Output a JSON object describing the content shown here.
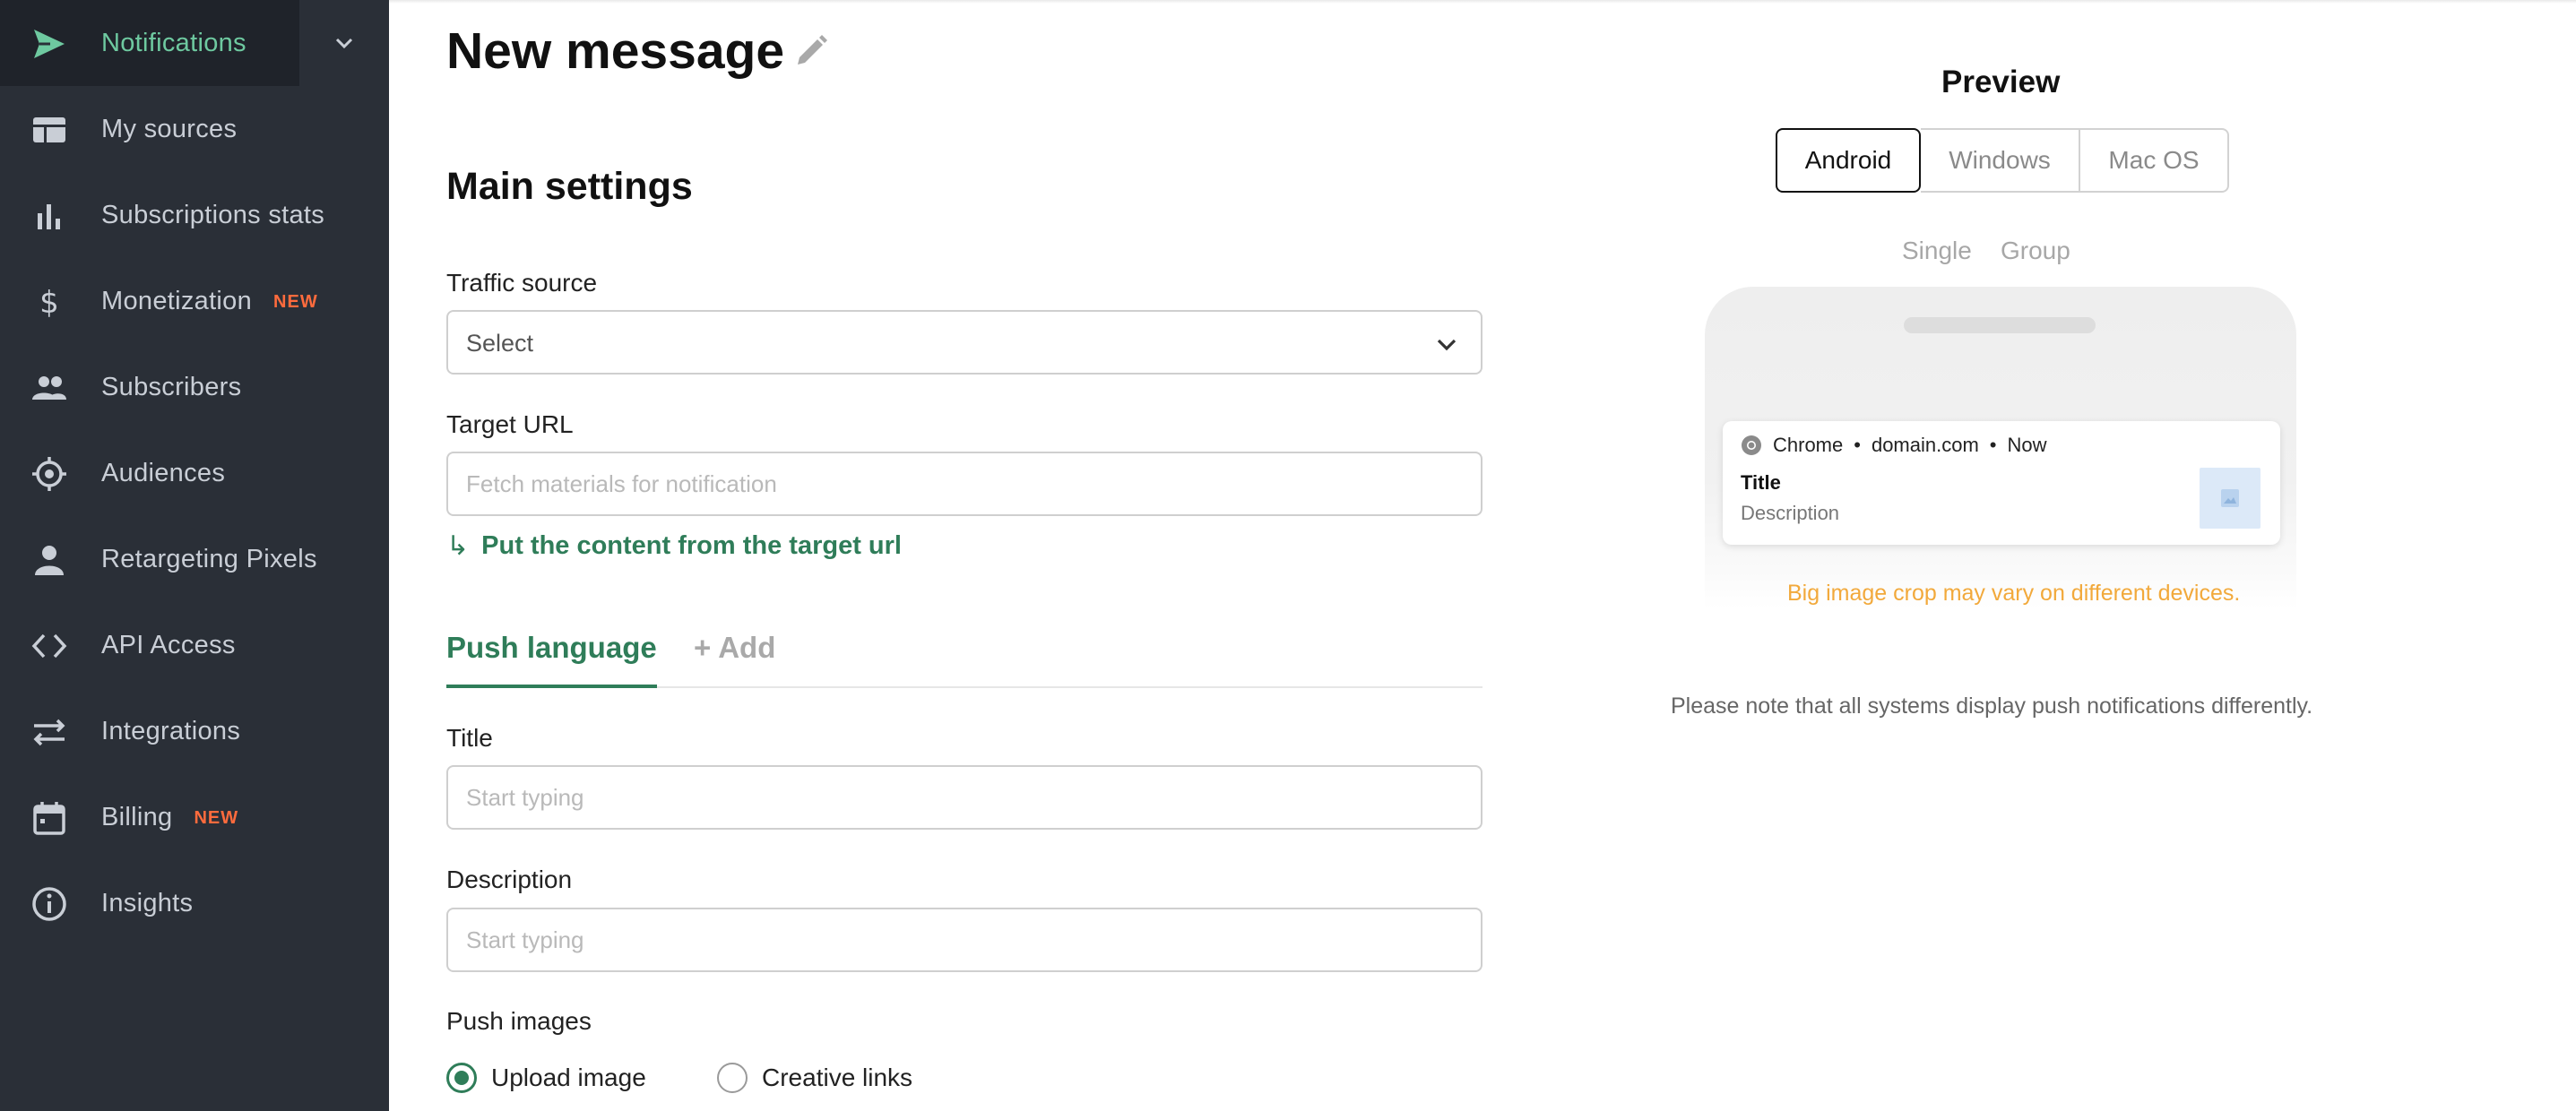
{
  "sidebar": {
    "items": [
      {
        "label": "Notifications",
        "icon": "send-icon",
        "active": true
      },
      {
        "label": "My sources",
        "icon": "sources-icon"
      },
      {
        "label": "Subscriptions stats",
        "icon": "bar-chart-icon"
      },
      {
        "label": "Monetization",
        "icon": "dollar-icon",
        "badge": "NEW"
      },
      {
        "label": "Subscribers",
        "icon": "people-icon"
      },
      {
        "label": "Audiences",
        "icon": "target-icon"
      },
      {
        "label": "Retargeting Pixels",
        "icon": "person-icon"
      },
      {
        "label": "API Access",
        "icon": "code-icon"
      },
      {
        "label": "Integrations",
        "icon": "arrows-swap-icon"
      },
      {
        "label": "Billing",
        "icon": "calendar-icon",
        "badge": "NEW"
      },
      {
        "label": "Insights",
        "icon": "info-icon"
      }
    ],
    "accent_color": "#6ec9a0",
    "background": "#2a2f37"
  },
  "page": {
    "title": "New message",
    "section_title": "Main settings"
  },
  "form": {
    "traffic_source": {
      "label": "Traffic source",
      "value": "Select"
    },
    "target_url": {
      "label": "Target URL",
      "placeholder": "Fetch materials for notification",
      "value": ""
    },
    "target_link": {
      "arrow": "↳",
      "label": "Put the content from the target url"
    },
    "tabs": {
      "active": "Push language",
      "add": "+ Add"
    },
    "title": {
      "label": "Title",
      "placeholder": "Start typing",
      "value": ""
    },
    "description": {
      "label": "Description",
      "placeholder": "Start typing",
      "value": ""
    },
    "push_images": {
      "label": "Push images",
      "options": [
        {
          "label": "Upload image",
          "checked": true
        },
        {
          "label": "Creative links",
          "checked": false
        }
      ]
    },
    "accent_color": "#2f7d59"
  },
  "preview": {
    "title": "Preview",
    "platforms": [
      "Android",
      "Windows",
      "Mac OS"
    ],
    "selected_platform": "Android",
    "modes": [
      "Single",
      "Group"
    ],
    "notification": {
      "browser": "Chrome",
      "separator": "•",
      "domain": "domain.com",
      "time": "Now",
      "title": "Title",
      "description": "Description"
    },
    "warning": "Big image crop may vary on different devices.",
    "note": "Please note that all systems display push notifications differently.",
    "warning_color": "#f2a93b"
  }
}
